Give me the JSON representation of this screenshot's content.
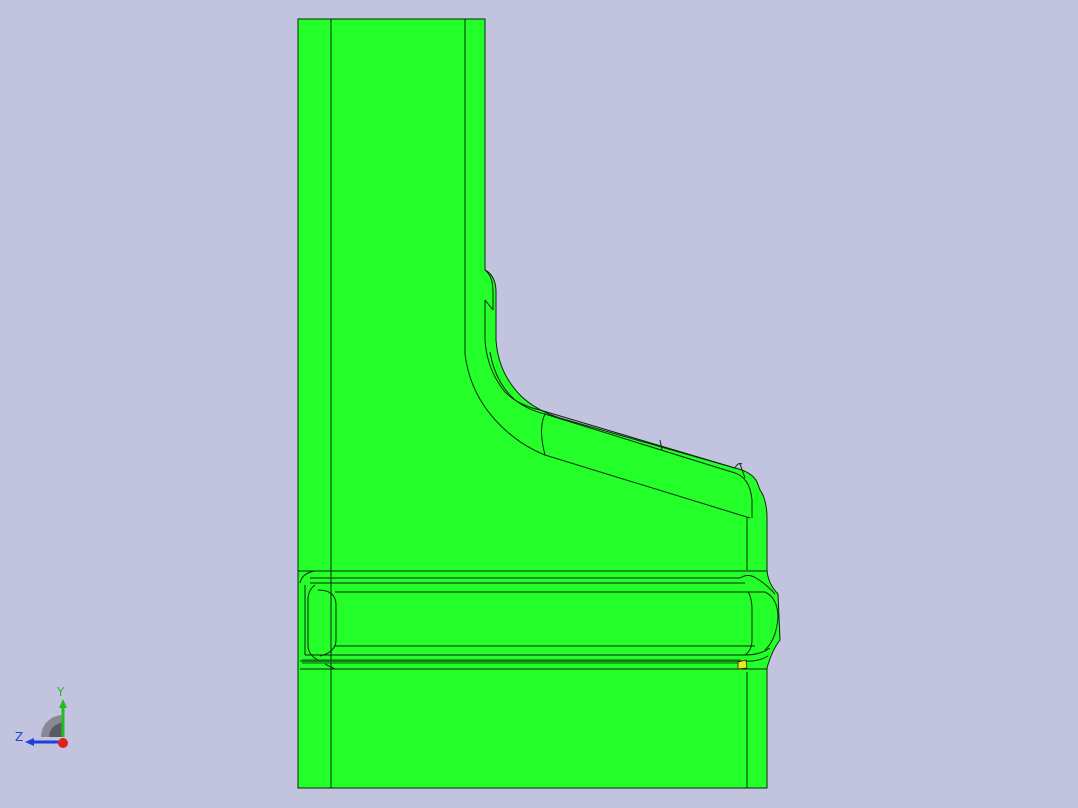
{
  "viewport": {
    "background": "#c1c3df"
  },
  "model": {
    "face_color": "#24ff2a",
    "edge_color": "#0a2a0a",
    "highlight_color": "#f5e02a"
  },
  "triad": {
    "y_label": "Y",
    "z_label": "Z",
    "y_color": "#1fbf1f",
    "z_color": "#1f3fd8",
    "x_color": "#e02020"
  }
}
